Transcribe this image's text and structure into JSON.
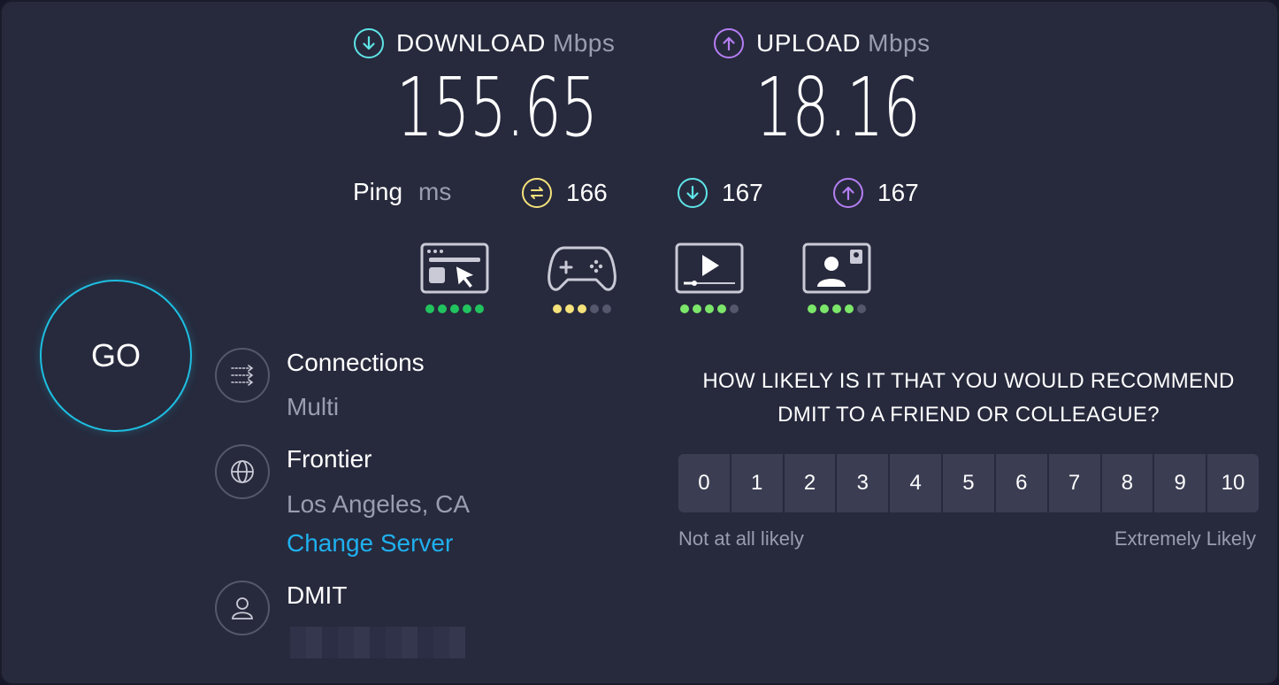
{
  "download": {
    "label": "DOWNLOAD",
    "unit": "Mbps",
    "value": "155.65",
    "icon": "arrow-down-circle-icon",
    "color": "#5ee4e7"
  },
  "upload": {
    "label": "UPLOAD",
    "unit": "Mbps",
    "value": "18.16",
    "icon": "arrow-up-circle-icon",
    "color": "#b57ef3"
  },
  "ping": {
    "label": "Ping",
    "unit": "ms",
    "idle": {
      "value": "166",
      "icon": "latency-idle-icon",
      "color": "#f5e27a"
    },
    "download": {
      "value": "167",
      "icon": "latency-download-icon",
      "color": "#5ee4e7"
    },
    "upload": {
      "value": "167",
      "icon": "latency-upload-icon",
      "color": "#b57ef3"
    }
  },
  "activities": [
    {
      "name": "web-browsing-icon",
      "rating": 5,
      "of": 5,
      "color": "#21c35e"
    },
    {
      "name": "gaming-icon",
      "rating": 3,
      "of": 5,
      "color": "#f5e27a"
    },
    {
      "name": "video-streaming-icon",
      "rating": 4,
      "of": 5,
      "color": "#7ce66a"
    },
    {
      "name": "video-chat-icon",
      "rating": 4,
      "of": 5,
      "color": "#7ce66a"
    }
  ],
  "go_label": "GO",
  "connections": {
    "title": "Connections",
    "value": "Multi"
  },
  "server": {
    "title": "Frontier",
    "location": "Los Angeles, CA",
    "change_label": "Change Server"
  },
  "provider": {
    "title": "DMIT"
  },
  "survey": {
    "question": "HOW LIKELY IS IT THAT YOU WOULD RECOMMEND DMIT TO A FRIEND OR COLLEAGUE?",
    "options": [
      "0",
      "1",
      "2",
      "3",
      "4",
      "5",
      "6",
      "7",
      "8",
      "9",
      "10"
    ],
    "low_label": "Not at all likely",
    "high_label": "Extremely Likely"
  }
}
